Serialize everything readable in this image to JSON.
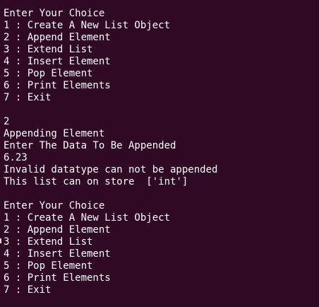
{
  "terminal": {
    "lines": [
      "Enter Your Choice",
      "1 : Create A New List Object",
      "2 : Append Element",
      "3 : Extend List",
      "4 : Insert Element",
      "5 : Pop Element",
      "6 : Print Elements",
      "7 : Exit",
      "",
      "2",
      "Appending Element",
      "Enter The Data To Be Appended",
      "6.23",
      "Invalid datatype can not be appended",
      "This list can on store  ['int']",
      "",
      "Enter Your Choice",
      "1 : Create A New List Object",
      "2 : Append Element",
      "3 : Extend List",
      "4 : Insert Element",
      "5 : Pop Element",
      "6 : Print Elements",
      "7 : Exit"
    ]
  },
  "colors": {
    "background": "#300a24",
    "text": "#ffffff"
  }
}
